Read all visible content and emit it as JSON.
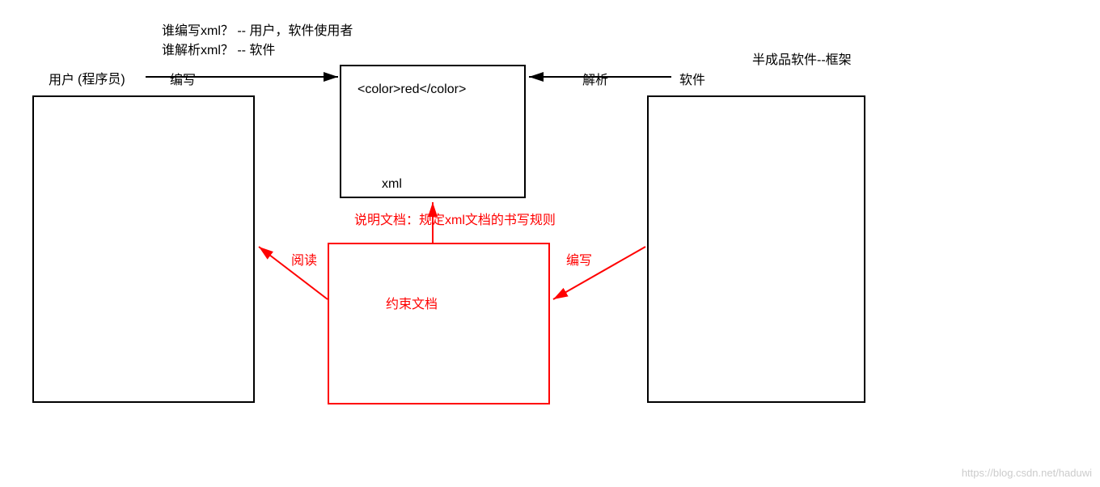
{
  "header": {
    "q1": "谁编写xml？ -- 用户，软件使用者",
    "q2": "谁解析xml？ -- 软件"
  },
  "user": {
    "label": "用户",
    "sub": "(程序员)"
  },
  "arrows": {
    "write": "编写",
    "parse": "解析",
    "read": "阅读",
    "write2": "编写"
  },
  "xmlbox": {
    "content": "<color>red</color>",
    "label": "xml"
  },
  "software": {
    "label": "软件",
    "sub": "半成品软件--框架"
  },
  "constraint": {
    "desc": "说明文档：规定xml文档的书写规则",
    "label": "约束文档"
  },
  "watermark": "https://blog.csdn.net/haduwi"
}
